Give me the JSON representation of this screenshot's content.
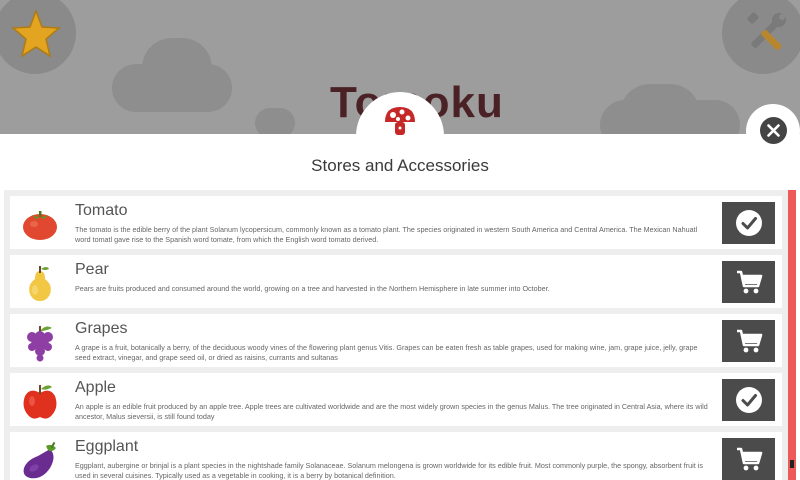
{
  "background": {
    "game_title": "Tomoku"
  },
  "modal": {
    "title": "Stores and Accessories",
    "items": [
      {
        "name": "Tomato",
        "icon": "tomato-icon",
        "description": "The tomato is the edible berry of the plant Solanum lycopersicum, commonly known as a tomato plant. The species originated in western South America and Central America. The Mexican Nahuatl word tomatl gave rise to the Spanish word tomate, from which the English word tomato derived.",
        "action": "owned",
        "action_icon": "check-icon"
      },
      {
        "name": "Pear",
        "icon": "pear-icon",
        "description": "Pears are fruits produced and consumed around the world, growing on a tree and harvested in the Northern Hemisphere in late summer into October.",
        "action": "buy",
        "action_icon": "cart-icon"
      },
      {
        "name": "Grapes",
        "icon": "grapes-icon",
        "description": "A grape is a fruit, botanically a berry, of the deciduous woody vines of the flowering plant genus Vitis. Grapes can be eaten fresh as table grapes, used for making wine, jam, grape juice, jelly, grape seed extract, vinegar, and grape seed oil, or dried as raisins, currants and sultanas",
        "action": "buy",
        "action_icon": "cart-icon"
      },
      {
        "name": "Apple",
        "icon": "apple-icon",
        "description": "An apple is an edible fruit produced by an apple tree. Apple trees are cultivated worldwide and are the most widely grown species in the genus Malus. The tree originated in Central Asia, where its wild ancestor, Malus sieversii, is still found today",
        "action": "owned",
        "action_icon": "check-icon"
      },
      {
        "name": "Eggplant",
        "icon": "eggplant-icon",
        "description": "Eggplant, aubergine or brinjal is a plant species in the nightshade family Solanaceae. Solanum melongena is grown worldwide for its edible fruit. Most commonly purple, the spongy, absorbent fruit is used in several cuisines. Typically used as a vegetable in cooking, it is a berry by botanical definition.",
        "action": "buy",
        "action_icon": "cart-icon"
      }
    ]
  },
  "colors": {
    "scrollbar": "#ee5a5a",
    "action_button": "#4b4b4b",
    "title_text": "#4a2226"
  }
}
